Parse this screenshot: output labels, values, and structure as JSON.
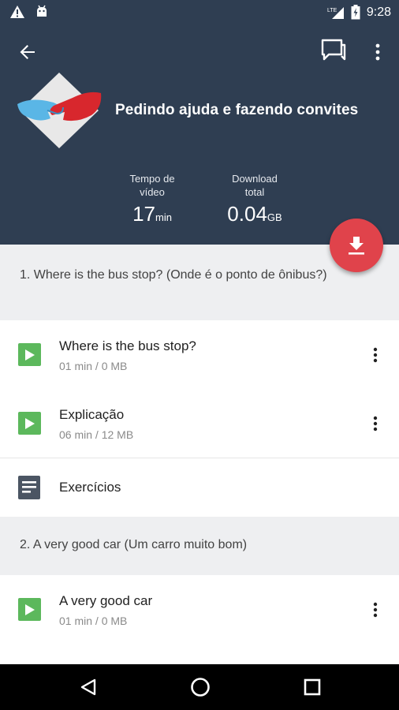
{
  "status_bar": {
    "time": "9:28",
    "icons": [
      "warning-icon",
      "android-icon",
      "signal-lte-icon",
      "battery-charging-icon"
    ]
  },
  "header": {
    "course_title": "Pedindo ajuda e fazendo convites",
    "stats": {
      "time_label": "Tempo de vídeo",
      "time_label_line1": "Tempo de",
      "time_label_line2": "vídeo",
      "time_value": "17",
      "time_unit": "min",
      "download_label_line1": "Download",
      "download_label_line2": "total",
      "download_value": "0.04",
      "download_unit": "GB"
    },
    "icons": {
      "back": "arrow-back-icon",
      "chat": "chat-icon",
      "menu": "more-vert-icon",
      "fab": "download-icon"
    },
    "colors": {
      "header_bg": "#2f3e52",
      "fab_bg": "#e0434b"
    }
  },
  "sections": [
    {
      "header": "1. Where is the bus stop? (Onde é o ponto de ônibus?)",
      "items": [
        {
          "type": "video",
          "title": "Where is the bus stop?",
          "meta": "01 min / 0 MB"
        },
        {
          "type": "video",
          "title": "Explicação",
          "meta": "06 min / 12 MB"
        },
        {
          "type": "exercise",
          "title": "Exercícios"
        }
      ]
    },
    {
      "header": "2. A very good car (Um carro muito bom)",
      "items": [
        {
          "type": "video",
          "title": "A very good car",
          "meta": "01 min / 0 MB"
        }
      ]
    }
  ],
  "colors": {
    "play_green": "#5cb85c",
    "section_bg": "#eeeff1"
  },
  "nav_bar": {
    "icons": [
      "nav-back-icon",
      "nav-home-icon",
      "nav-recents-icon"
    ]
  }
}
